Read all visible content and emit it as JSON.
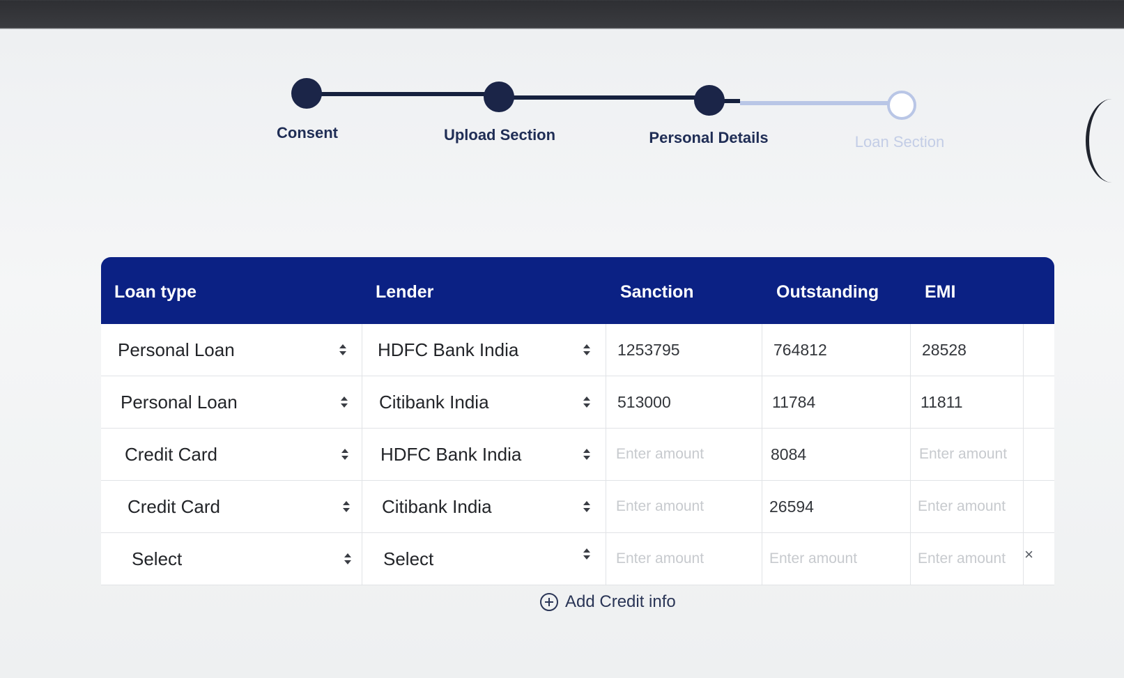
{
  "stepper": {
    "steps": [
      {
        "label": "Consent",
        "status": "done"
      },
      {
        "label": "Upload Section",
        "status": "done"
      },
      {
        "label": "Personal Details",
        "status": "current"
      },
      {
        "label": "Loan Section",
        "status": "pending"
      }
    ]
  },
  "table": {
    "headers": {
      "loan_type": "Loan type",
      "lender": "Lender",
      "sanction": "Sanction",
      "outstanding": "Outstanding",
      "emi": "EMI"
    },
    "placeholder": "Enter amount",
    "rows": [
      {
        "loan_type": "Personal Loan",
        "lender": "HDFC Bank India",
        "sanction": "1253795",
        "outstanding": "764812",
        "emi": "28528"
      },
      {
        "loan_type": "Personal Loan",
        "lender": "Citibank India",
        "sanction": "513000",
        "outstanding": "11784",
        "emi": "11811"
      },
      {
        "loan_type": "Credit Card",
        "lender": "HDFC Bank India",
        "sanction": "",
        "outstanding": "8084",
        "emi": ""
      },
      {
        "loan_type": "Credit Card",
        "lender": "Citibank India",
        "sanction": "",
        "outstanding": "26594",
        "emi": ""
      },
      {
        "loan_type": "Select",
        "lender": "Select",
        "sanction": "",
        "outstanding": "",
        "emi": ""
      }
    ],
    "remove_label": "×"
  },
  "add_credit_label": "Add Credit info",
  "colors": {
    "header_bg": "#0b2184",
    "step_done": "#1b2548",
    "step_pending": "#b9c6e6"
  }
}
